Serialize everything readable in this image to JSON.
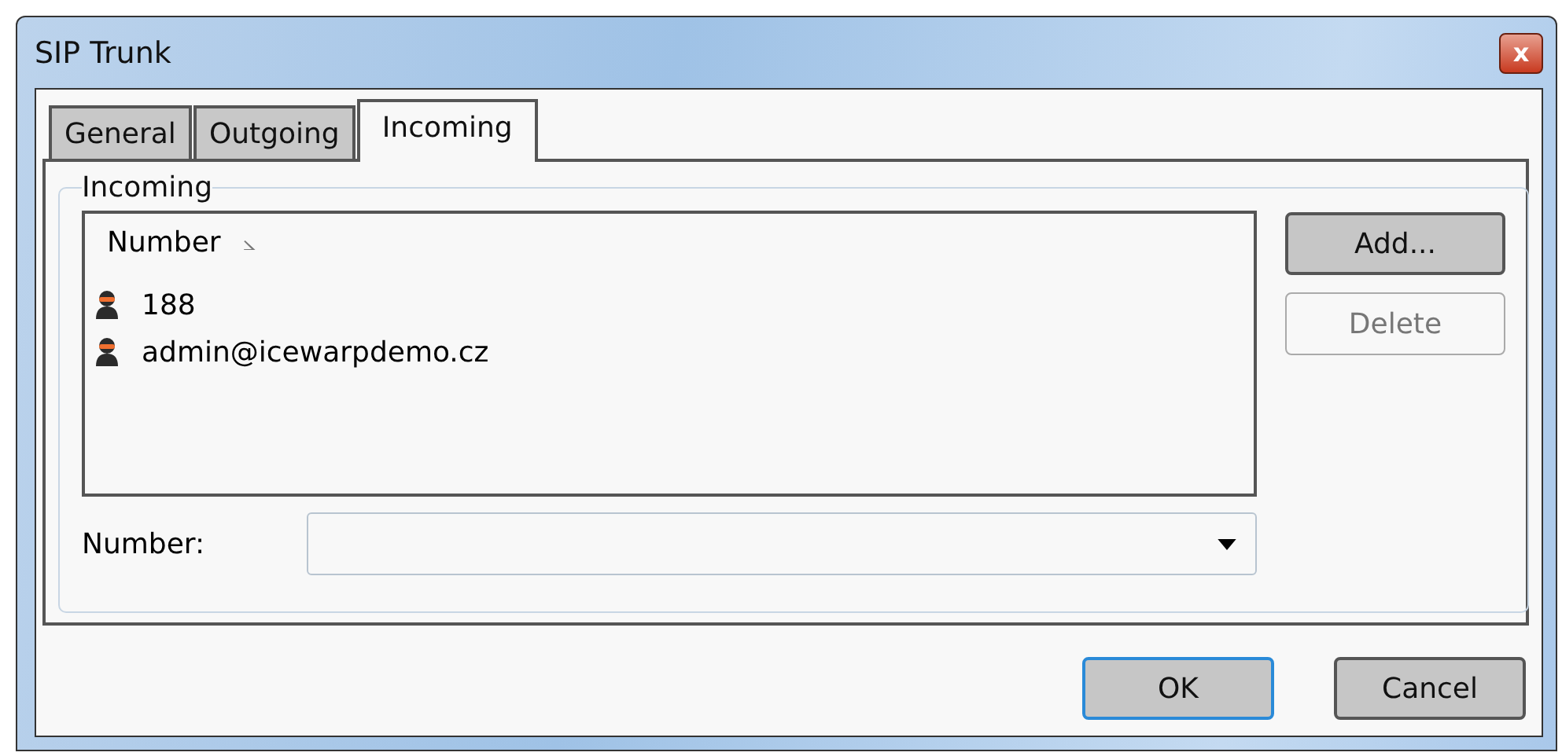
{
  "window": {
    "title": "SIP Trunk",
    "close_label": "x"
  },
  "tabs": [
    {
      "label": "General",
      "selected": false
    },
    {
      "label": "Outgoing",
      "selected": false
    },
    {
      "label": "Incoming",
      "selected": true
    }
  ],
  "group": {
    "title": "Incoming"
  },
  "list": {
    "column": "Number",
    "sort_mark": "⦣",
    "rows": [
      "188",
      "admin@icewarpdemo.cz"
    ]
  },
  "side_buttons": [
    {
      "label": "Add...",
      "disabled": false
    },
    {
      "label": "Delete",
      "disabled": true
    }
  ],
  "number_field": {
    "label": "Number:"
  },
  "buttons": [
    {
      "label": "OK",
      "default": true
    },
    {
      "label": "Cancel",
      "default": false
    }
  ]
}
